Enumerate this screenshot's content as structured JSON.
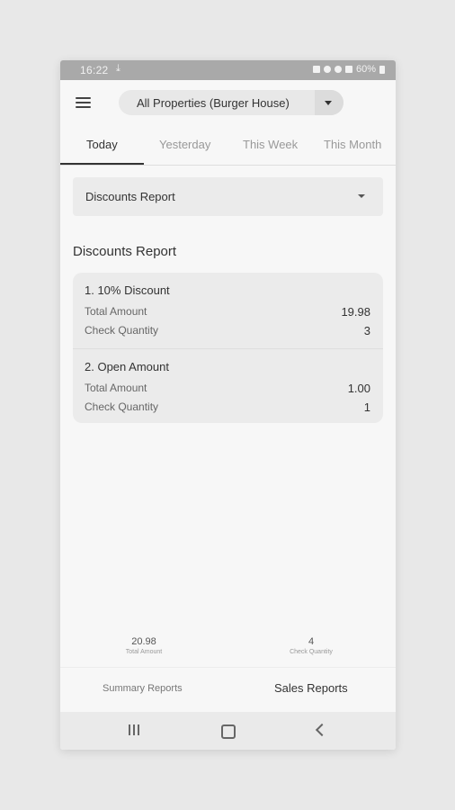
{
  "status_bar": {
    "time": "16:22",
    "battery": "60%"
  },
  "header": {
    "property_selector": "All Properties (Burger House)"
  },
  "tabs": [
    {
      "label": "Today",
      "active": true
    },
    {
      "label": "Yesterday",
      "active": false
    },
    {
      "label": "This Week",
      "active": false
    },
    {
      "label": "This Month",
      "active": false
    }
  ],
  "report_selector": {
    "value": "Discounts Report"
  },
  "section": {
    "title": "Discounts Report"
  },
  "discounts": [
    {
      "name": "1. 10% Discount",
      "total_amount_label": "Total Amount",
      "total_amount": "19.98",
      "check_quantity_label": "Check Quantity",
      "check_quantity": "3"
    },
    {
      "name": "2. Open Amount",
      "total_amount_label": "Total Amount",
      "total_amount": "1.00",
      "check_quantity_label": "Check Quantity",
      "check_quantity": "1"
    }
  ],
  "totals": {
    "total_amount": "20.98",
    "total_amount_label": "Total Amount",
    "check_quantity": "4",
    "check_quantity_label": "Check Quantity"
  },
  "bottom_tabs": [
    {
      "label": "Summary Reports",
      "active": false
    },
    {
      "label": "Sales Reports",
      "active": true
    }
  ],
  "colors": {
    "accent": "#333333",
    "card_bg": "#ebebeb",
    "status_bar": "#a9a9a9"
  }
}
